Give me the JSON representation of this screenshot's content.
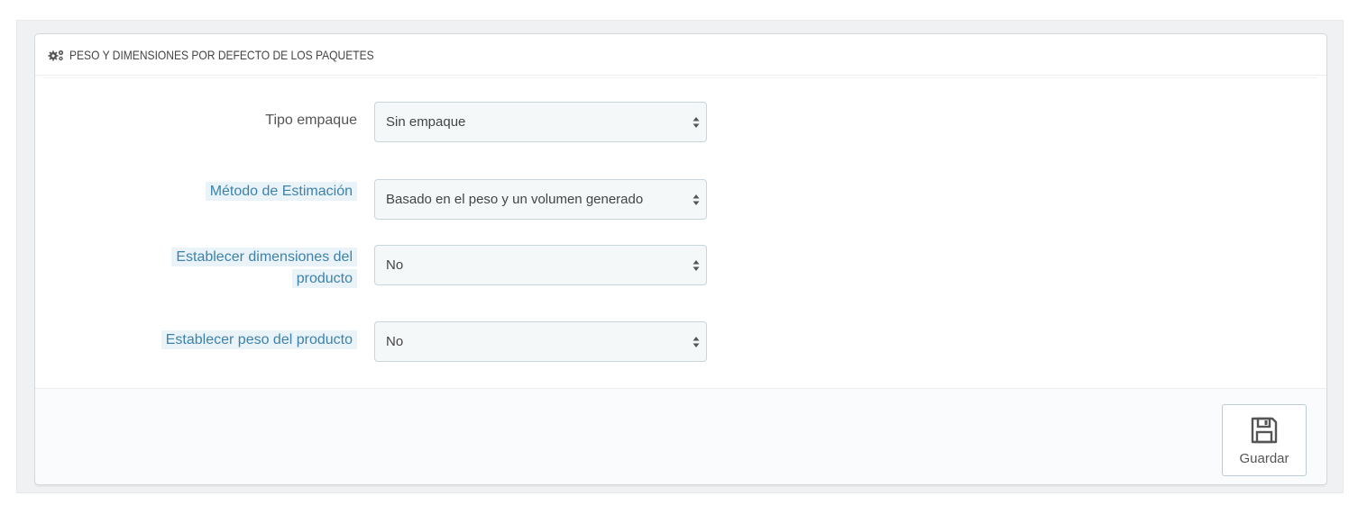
{
  "panel": {
    "title": "PESO Y DIMENSIONES POR DEFECTO DE LOS PAQUETES",
    "header_icon": "gears-icon"
  },
  "form": {
    "fields": [
      {
        "label": "Tipo empaque",
        "value": "Sin empaque",
        "has_help": false
      },
      {
        "label": "Método de Estimación",
        "value": "Basado en el peso y un volumen generado",
        "has_help": true
      },
      {
        "label_line1": "Establecer dimensiones del",
        "label_line2": "producto",
        "value": "No",
        "has_help": true
      },
      {
        "label": "Establecer peso del producto",
        "value": "No",
        "has_help": true
      }
    ]
  },
  "footer": {
    "save_label": "Guardar",
    "save_icon": "floppy-disk-icon"
  },
  "colors": {
    "help_label_text": "#3c82ac",
    "help_label_bg": "#eaf3f8",
    "select_bg": "#f5f8f9"
  }
}
